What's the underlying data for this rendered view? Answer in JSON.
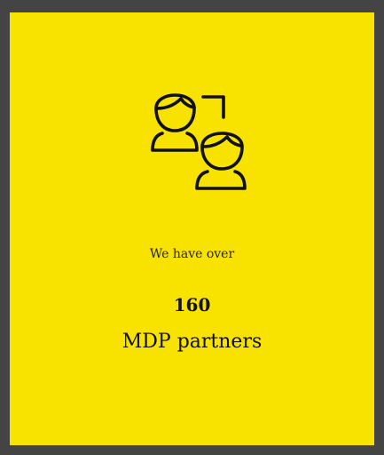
{
  "card": {
    "background_color": "#f7e200",
    "icon": "partners-icon"
  },
  "text": {
    "intro": "We have over",
    "count": "160",
    "label": "MDP partners"
  },
  "frame_color": "#444444"
}
